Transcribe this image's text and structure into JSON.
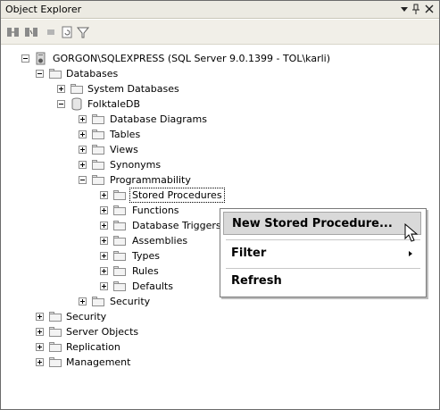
{
  "panel": {
    "title": "Object Explorer",
    "dropdown_glyph": "▾",
    "pin_glyph": "ᵖ",
    "close_glyph": "✕"
  },
  "toolbar": {
    "icons": [
      "connect-icon",
      "disconnect-icon",
      "stop-icon",
      "refresh-icon",
      "filter-icon"
    ]
  },
  "tree": {
    "server": "GORGON\\SQLEXPRESS (SQL Server 9.0.1399 - TOL\\karli)",
    "databases": "Databases",
    "system_databases": "System Databases",
    "folktaledb": "FolktaleDB",
    "database_diagrams": "Database Diagrams",
    "tables": "Tables",
    "views": "Views",
    "synonyms": "Synonyms",
    "programmability": "Programmability",
    "stored_procedures": "Stored Procedures",
    "functions": "Functions",
    "database_triggers": "Database Triggers",
    "assemblies": "Assemblies",
    "types": "Types",
    "rules": "Rules",
    "defaults": "Defaults",
    "db_security": "Security",
    "security": "Security",
    "server_objects": "Server Objects",
    "replication": "Replication",
    "management": "Management"
  },
  "context_menu": {
    "new_stored_procedure": "New Stored Procedure...",
    "filter": "Filter",
    "refresh": "Refresh"
  },
  "colors": {
    "title_bg": "#eceae2",
    "menu_highlight": "#d9d9d9"
  }
}
